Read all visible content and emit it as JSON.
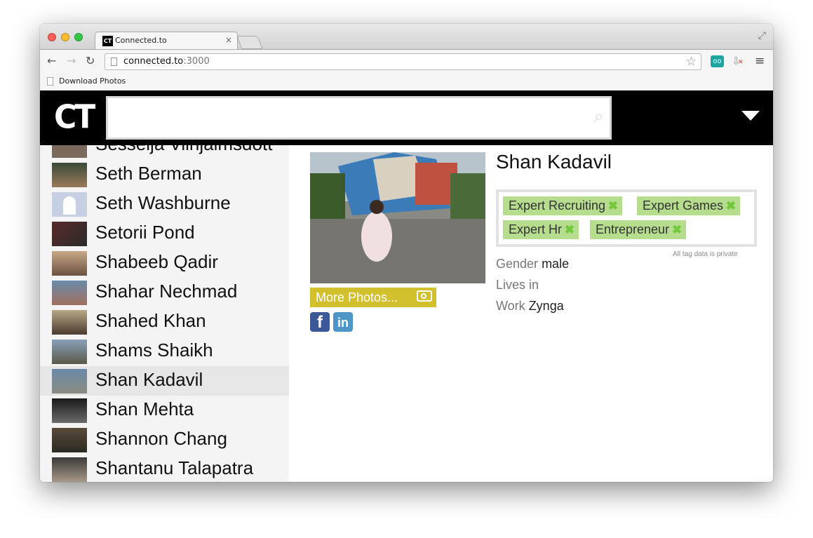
{
  "browser": {
    "tab_title": "Connected.to",
    "tab_favicon": "CT",
    "tab_close": "×",
    "url_host": "connected.to",
    "url_port": ":3000",
    "back_glyph": "←",
    "forward_glyph": "→",
    "reload_glyph": "↻",
    "star_glyph": "☆",
    "menu_glyph": "≡",
    "ext_glyph": "oo",
    "download_glyph": "⇩",
    "fullscreen_glyph": "⤢",
    "bookmark_label": "Download Photos"
  },
  "header": {
    "logo": "CT",
    "search_placeholder": "",
    "search_glyph": "⌕"
  },
  "sidebar": {
    "items": [
      {
        "name": "Sesselja Vilhjálmsdótt"
      },
      {
        "name": "Seth Berman"
      },
      {
        "name": "Seth Washburne"
      },
      {
        "name": "Setorii Pond"
      },
      {
        "name": "Shabeeb Qadir"
      },
      {
        "name": "Shahar Nechmad"
      },
      {
        "name": "Shahed Khan"
      },
      {
        "name": "Shams Shaikh"
      },
      {
        "name": "Shan Kadavil"
      },
      {
        "name": "Shan Mehta"
      },
      {
        "name": "Shannon Chang"
      },
      {
        "name": "Shantanu Talapatra"
      }
    ],
    "active_index": 8
  },
  "profile": {
    "name": "Shan Kadavil",
    "more_photos_label": "More Photos...",
    "facebook_glyph": "f",
    "linkedin_glyph": "in",
    "tags": [
      {
        "label": "Expert Recruiting"
      },
      {
        "label": "Expert Games"
      },
      {
        "label": "Expert Hr"
      },
      {
        "label": "Entrepreneur"
      }
    ],
    "tag_remove_glyph": "✖",
    "privacy_note": "All tag data is private",
    "gender_label": "Gender",
    "gender_value": "male",
    "lives_label": "Lives in",
    "lives_value": "",
    "work_label": "Work",
    "work_value": "Zynga"
  },
  "colors": {
    "tag_bg": "#b5dd8d",
    "tag_x": "#72c83a",
    "more_photos_bg": "#d2c02d",
    "header_bg": "#000000"
  }
}
